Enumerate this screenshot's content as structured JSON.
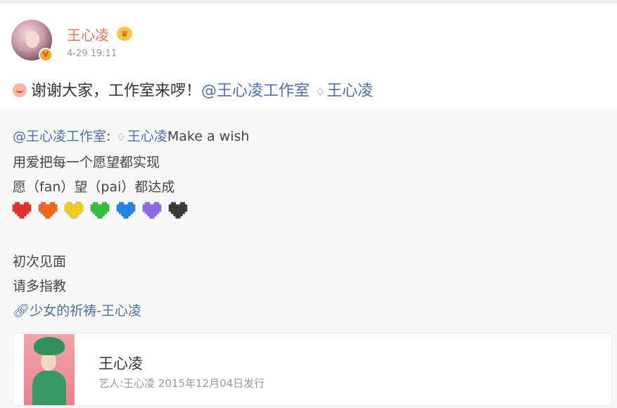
{
  "post": {
    "username": "王心凌",
    "avatar_badge": "V",
    "time": "4-29 19:11",
    "text_prefix": "谢谢大家，工作室来啰！",
    "mention": "@王心凌工作室",
    "topic": "王心凌"
  },
  "repost": {
    "mention": "@王心凌工作室",
    "colon": ":",
    "topic": "王心凌",
    "line1_rest": "Make a wish",
    "line2": "用爱把每一个愿望都实现",
    "line3": "愿（fan）望（pai）都达成",
    "hearts": [
      "#e8302d",
      "#f26b1d",
      "#f5d11a",
      "#2fc23a",
      "#1f87e8",
      "#8f6ae6",
      "#3a3a3a"
    ],
    "line5": "初次见面",
    "line6": "请多指教",
    "music_link": "少女的祈祷-王心凌"
  },
  "card": {
    "title": "王心凌",
    "subtitle": "艺人:王心凌 2015年12月04日发行"
  },
  "colors": {
    "name": "#eb7350",
    "link": "#4a6fa5",
    "muted": "#999999"
  }
}
